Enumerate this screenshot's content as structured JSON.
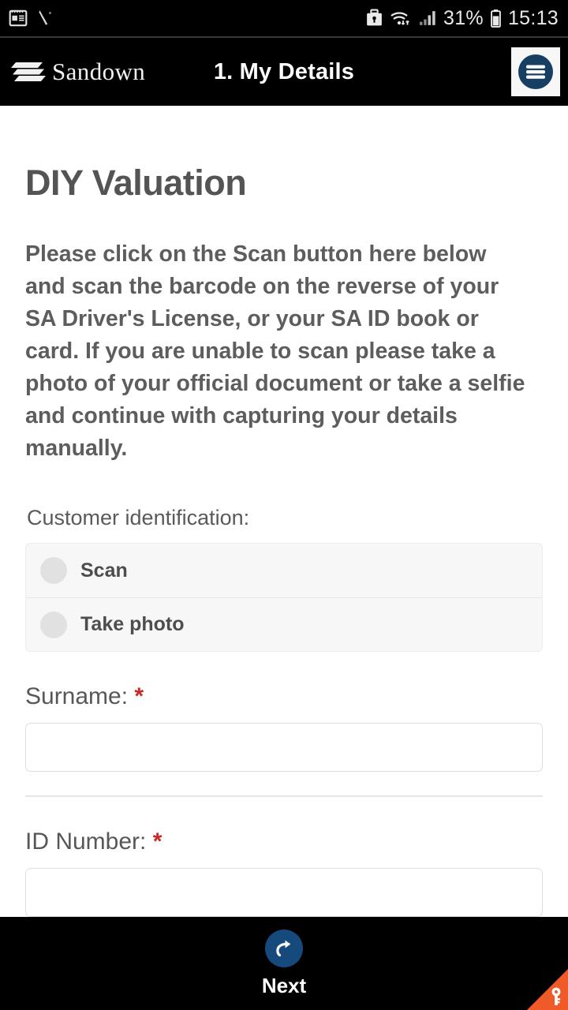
{
  "status_bar": {
    "left_icons": [
      "news-notepad-icon",
      "pen-slash-icon"
    ],
    "right_icons": [
      "work-profile-briefcase-icon",
      "wifi-transfer-icon",
      "cellular-signal-icon",
      "battery-icon"
    ],
    "battery_percent": "31%",
    "time": "15:13"
  },
  "app_bar": {
    "brand": "Sandown",
    "brand_logo_icon": "sandown-stripes-logo-icon",
    "title": "1. My Details",
    "menu_icon": "hamburger-menu-icon"
  },
  "main": {
    "page_title": "DIY Valuation",
    "intro_paragraph": "Please click on the Scan button here below and scan the barcode on the reverse of your SA Driver's License, or your SA ID book or card. If you are unable to scan please take a photo of your official document or take a selfie and continue with capturing your details manually.",
    "identification": {
      "label": "Customer identification:",
      "options": [
        {
          "label": "Scan",
          "selected": false
        },
        {
          "label": "Take photo",
          "selected": false
        }
      ]
    },
    "fields": [
      {
        "label": "Surname:",
        "required_mark": "*",
        "value": "",
        "placeholder": ""
      },
      {
        "label": "ID Number:",
        "required_mark": "*",
        "value": "",
        "placeholder": ""
      }
    ]
  },
  "bottom_bar": {
    "next_label": "Next",
    "next_icon": "forward-arrow-icon",
    "corner_icon": "key-icon"
  },
  "colors": {
    "bar_background": "#000000",
    "accent_blue": "#164a7d",
    "required_red": "#c62828",
    "corner_orange": "#f05a28",
    "text_gray": "#575757",
    "card_background": "#f7f7f7"
  }
}
